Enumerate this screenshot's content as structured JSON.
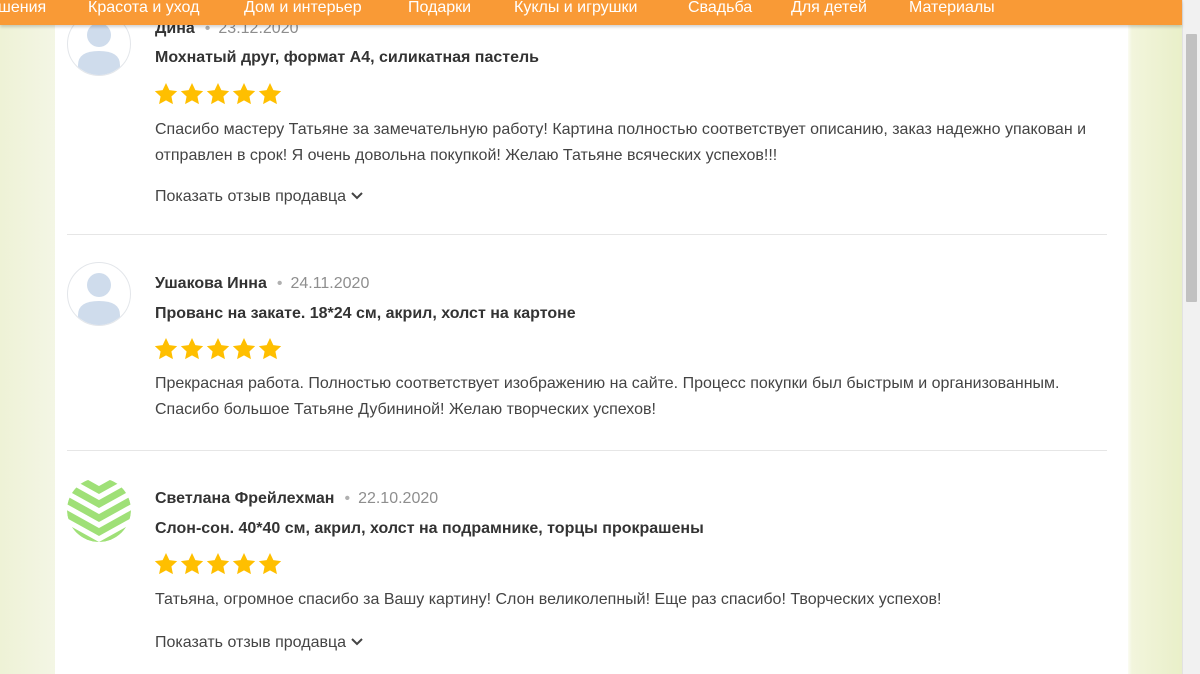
{
  "nav": {
    "items": [
      "шения",
      "Красота и уход",
      "Дом и интерьер",
      "Подарки",
      "Куклы и игрушки",
      "Свадьба",
      "Для детей",
      "Материалы"
    ]
  },
  "colors": {
    "nav_bg": "#f99a36",
    "star": "#ffbf00",
    "avatar_default": "#cfdcec",
    "avatar_stripes": "#9fe077"
  },
  "reviews": [
    {
      "author": "Дина",
      "date": "23.12.2020",
      "product": "Мохнатый друг, формат А4, силикатная пастель",
      "rating": 5,
      "text": "Спасибо мастеру Татьяне за замечательную работу! Картина полностью соответствует описанию, заказ надежно упакован и отправлен в срок! Я очень довольна покупкой! Желаю Татьяне всяческих успехов!!!",
      "seller_link": "Показать отзыв продавца",
      "avatar": "default-user-icon"
    },
    {
      "author": "Ушакова Инна",
      "date": "24.11.2020",
      "product": "Прованс на закате. 18*24 см, акрил, холст на картоне",
      "rating": 5,
      "text": "Прекрасная работа. Полностью соответствует изображению на сайте. Процесс покупки был быстрым и организованным. Спасибо большое Татьяне Дубининой! Желаю творческих успехов!",
      "avatar": "default-user-icon"
    },
    {
      "author": "Светлана Фрейлехман",
      "date": "22.10.2020",
      "product": "Слон-сон. 40*40 см, акрил, холст на подрамнике, торцы прокрашены",
      "rating": 5,
      "text": "Татьяна, огромное спасибо за Вашу картину! Слон великолепный! Еще раз спасибо! Творческих успехов!",
      "seller_link": "Показать отзыв продавца",
      "avatar": "chevron-pattern-icon"
    }
  ]
}
